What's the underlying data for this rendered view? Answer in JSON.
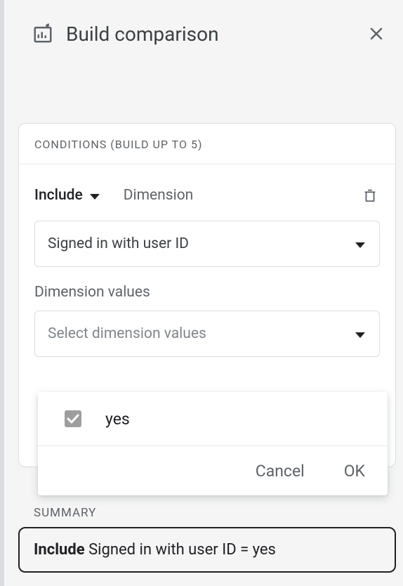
{
  "header": {
    "title": "Build comparison"
  },
  "conditions": {
    "heading": "CONDITIONS (BUILD UP TO 5)",
    "include_label": "Include",
    "dimension_label": "Dimension",
    "dimension_select_value": "Signed in with user ID",
    "values_field_label": "Dimension values",
    "values_select_placeholder": "Select dimension values"
  },
  "dropdown": {
    "options": [
      {
        "label": "yes",
        "checked": true
      }
    ],
    "cancel_label": "Cancel",
    "ok_label": "OK"
  },
  "summary": {
    "heading": "SUMMARY",
    "strong": "Include",
    "rest": " Signed in with user ID = yes"
  }
}
